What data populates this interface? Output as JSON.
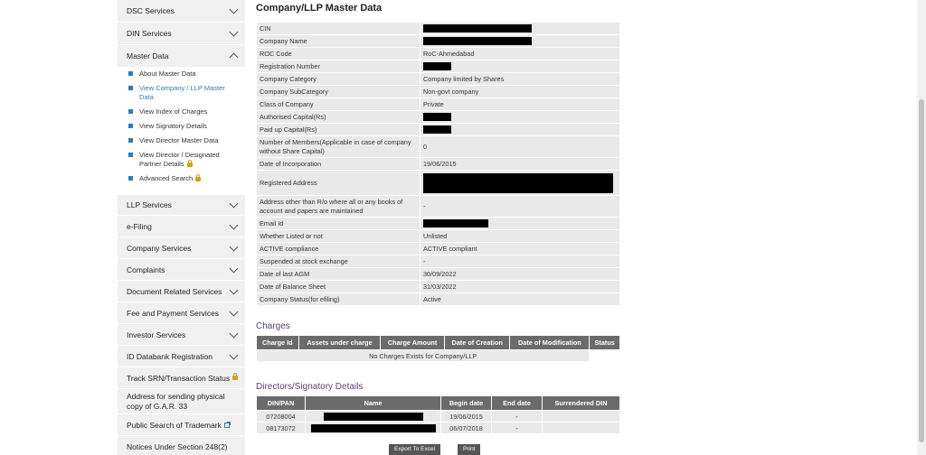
{
  "sidebar": {
    "top_items": [
      {
        "label": "DSC Services"
      },
      {
        "label": "DIN Services"
      },
      {
        "label": "Master Data"
      }
    ],
    "submenu": [
      {
        "label": "About Master Data"
      },
      {
        "label": "View Company / LLP Master Data"
      },
      {
        "label": "View Index of Charges"
      },
      {
        "label": "View Signatory Details"
      },
      {
        "label": "View Director Master Data"
      },
      {
        "label": "View Director / Designated Partner Details"
      },
      {
        "label": "Advanced Search"
      }
    ],
    "bottom_items": [
      {
        "label": "LLP Services"
      },
      {
        "label": "e-Filing"
      },
      {
        "label": "Company Services"
      },
      {
        "label": "Complaints"
      },
      {
        "label": "Document Related Services"
      },
      {
        "label": "Fee and Payment Services"
      },
      {
        "label": "Investor Services"
      },
      {
        "label": "ID Databank Registration"
      },
      {
        "label": "Track SRN/Transaction Status"
      },
      {
        "label": "Address for sending physical copy of G.A.R. 33"
      },
      {
        "label": "Public Search of Trademark"
      },
      {
        "label": "Notices Under Section 248(2)"
      }
    ]
  },
  "main": {
    "title": "Company/LLP Master Data",
    "rows": [
      {
        "label": "CIN",
        "value": ""
      },
      {
        "label": "Company Name",
        "value": ""
      },
      {
        "label": "ROC Code",
        "value": "RoC-Ahmedabad"
      },
      {
        "label": "Registration Number",
        "value": ""
      },
      {
        "label": "Company Category",
        "value": "Company limited by Shares"
      },
      {
        "label": "Company SubCategory",
        "value": "Non-govt company"
      },
      {
        "label": "Class of Company",
        "value": "Private"
      },
      {
        "label": "Authorised Capital(Rs)",
        "value": ""
      },
      {
        "label": "Paid up Capital(Rs)",
        "value": ""
      },
      {
        "label": "Number of Members(Applicable in case of company without Share Capital)",
        "value": "0"
      },
      {
        "label": "Date of Incorporation",
        "value": "19/06/2015"
      },
      {
        "label": "Registered Address",
        "value": ""
      },
      {
        "label": "Address other than R/o where all or any books of account and papers are maintained",
        "value": "-"
      },
      {
        "label": "Email Id",
        "value": ""
      },
      {
        "label": "Whether Listed or not",
        "value": "Unlisted"
      },
      {
        "label": "ACTIVE compliance",
        "value": "ACTIVE compliant"
      },
      {
        "label": "Suspended at stock exchange",
        "value": "-"
      },
      {
        "label": "Date of last AGM",
        "value": "30/09/2022"
      },
      {
        "label": "Date of Balance Sheet",
        "value": "31/03/2022"
      },
      {
        "label": "Company Status(for efiling)",
        "value": "Active"
      }
    ],
    "charges": {
      "title": "Charges",
      "headers": [
        "Charge Id",
        "Assets under charge",
        "Charge Amount",
        "Date of Creation",
        "Date of Modification",
        "Status"
      ],
      "empty_message": "No Charges Exists for Company/LLP"
    },
    "directors": {
      "title": "Directors/Signatory Details",
      "headers": [
        "DIN/PAN",
        "Name",
        "Begin date",
        "End date",
        "Surrendered DIN"
      ],
      "rows": [
        {
          "din": "07208004",
          "begin": "19/06/2015",
          "end": "-",
          "surrendered": ""
        },
        {
          "din": "08173072",
          "begin": "06/07/2018",
          "end": "-",
          "surrendered": ""
        }
      ]
    },
    "buttons": {
      "export": "Export To Excel",
      "print": "Print"
    }
  }
}
